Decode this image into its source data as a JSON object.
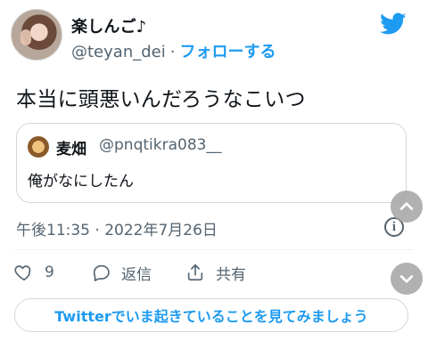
{
  "tweet": {
    "author_name": "楽しんご♪",
    "author_handle": "@teyan_dei",
    "separator": "·",
    "follow_label": "フォローする",
    "text": "本当に頭悪いんだろうなこいつ",
    "timestamp": "午後11:35 · 2022年7月26日",
    "actions": {
      "like_count": "9",
      "reply_label": "返信",
      "share_label": "共有"
    },
    "cta_label": "Twitterでいま起きていることを見てみましょう"
  },
  "quoted_tweet": {
    "author_name": "麦畑",
    "author_handle": "@pnqtikra083__",
    "text": "俺がなにしたん"
  },
  "icons": {
    "brand": "twitter-bird-icon",
    "info": "info-icon",
    "like": "heart-icon",
    "reply": "reply-bubble-icon",
    "share": "share-upload-icon",
    "scroll_up": "chevron-up-icon",
    "scroll_down": "chevron-down-icon"
  },
  "colors": {
    "accent": "#1d9bf0",
    "muted_text": "#536471",
    "border": "#cfd9de"
  }
}
